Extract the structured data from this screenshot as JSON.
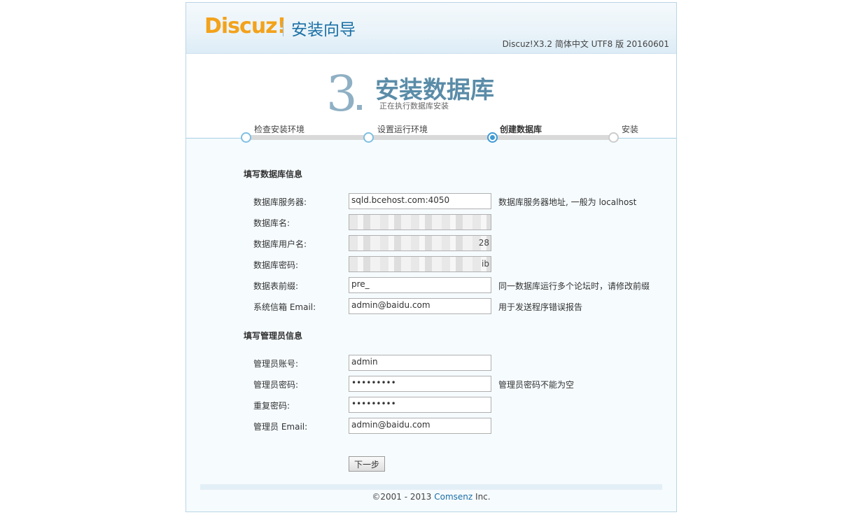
{
  "header": {
    "logo_text": "Discuz!",
    "title": "安装向导",
    "version": "Discuz!X3.2 简体中文 UTF8 版 20160601"
  },
  "step": {
    "number": "3",
    "title": "安装数据库",
    "subtitle": "正在执行数据库安装"
  },
  "steps": [
    {
      "label": "检查安装环境",
      "state": "done"
    },
    {
      "label": "设置运行环境",
      "state": "done"
    },
    {
      "label": "创建数据库",
      "state": "current"
    },
    {
      "label": "安装",
      "state": "pending"
    }
  ],
  "db_section": {
    "title": "填写数据库信息",
    "fields": [
      {
        "label": "数据库服务器:",
        "value": "sqld.bcehost.com:4050",
        "hint": "数据库服务器地址, 一般为 localhost"
      },
      {
        "label": "数据库名:",
        "value": "",
        "hint": ""
      },
      {
        "label": "数据库用户名:",
        "value": "",
        "visible_tail": "28",
        "hint": ""
      },
      {
        "label": "数据库密码:",
        "value": "",
        "visible_tail": "ib",
        "hint": ""
      },
      {
        "label": "数据表前缀:",
        "value": "pre_",
        "hint": "同一数据库运行多个论坛时，请修改前缀"
      },
      {
        "label": "系统信箱 Email:",
        "value": "admin@baidu.com",
        "hint": "用于发送程序错误报告"
      }
    ]
  },
  "admin_section": {
    "title": "填写管理员信息",
    "fields": [
      {
        "label": "管理员账号:",
        "value": "admin",
        "hint": ""
      },
      {
        "label": "管理员密码:",
        "value": "•••••••••",
        "hint": "管理员密码不能为空"
      },
      {
        "label": "重复密码:",
        "value": "•••••••••",
        "hint": ""
      },
      {
        "label": "管理员 Email:",
        "value": "admin@baidu.com",
        "hint": ""
      }
    ]
  },
  "next_button": "下一步",
  "footer": {
    "copyright": "©2001 - 2013 ",
    "company": "Comsenz",
    "suffix": " Inc."
  },
  "colors": {
    "logo": "#f3a21b",
    "accent": "#1a6fa5",
    "step_title": "#5a8ca8",
    "progress_active": "#3f9ad5"
  }
}
